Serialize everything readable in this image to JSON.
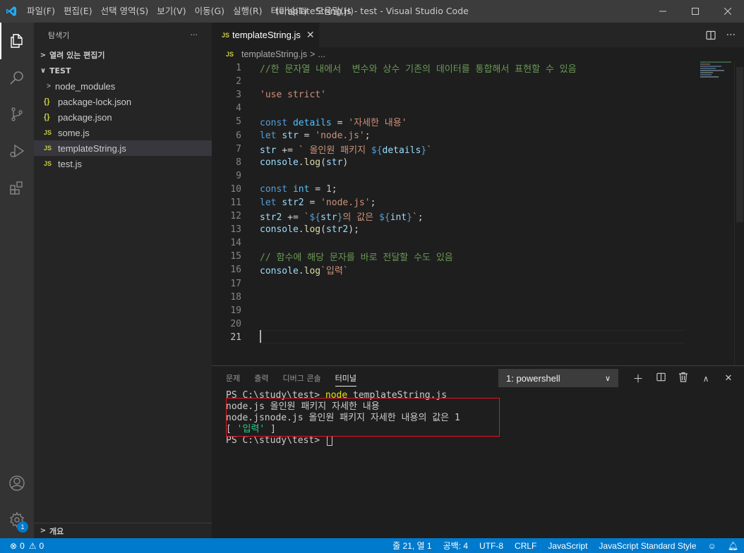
{
  "window": {
    "title": "templateString.js - test - Visual Studio Code",
    "menu": [
      "파일(F)",
      "편집(E)",
      "선택 영역(S)",
      "보기(V)",
      "이동(G)",
      "실행(R)",
      "터미널(T)",
      "도움말(H)"
    ]
  },
  "sidebar": {
    "header": "탐색기",
    "more": "···",
    "open_editors": "열려 있는 편집기",
    "folder": "TEST",
    "items": [
      {
        "icon": "",
        "label": "node_modules",
        "kind": "folder"
      },
      {
        "icon": "{}",
        "label": "package-lock.json",
        "kind": "json"
      },
      {
        "icon": "{}",
        "label": "package.json",
        "kind": "json"
      },
      {
        "icon": "JS",
        "label": "some.js",
        "kind": "js"
      },
      {
        "icon": "JS",
        "label": "templateString.js",
        "kind": "js"
      },
      {
        "icon": "JS",
        "label": "test.js",
        "kind": "js"
      }
    ],
    "outline": "개요"
  },
  "editor": {
    "tab_icon": "JS",
    "tab_label": "templateString.js",
    "tab_close": "✕",
    "breadcrumb_icon": "JS",
    "breadcrumb_file": "templateString.js",
    "breadcrumb_sep": ">",
    "breadcrumb_more": "...",
    "line_numbers": [
      "1",
      "2",
      "3",
      "4",
      "5",
      "6",
      "7",
      "8",
      "9",
      "10",
      "11",
      "12",
      "13",
      "14",
      "15",
      "16",
      "17",
      "18",
      "19",
      "20",
      "21"
    ],
    "lines": [
      {
        "text": "//한 문자열 내에서  변수와 상수 기존의 데이터를 통합해서 표현할 수 있음"
      },
      {
        "text": ""
      },
      {
        "text": "'use strict'"
      },
      {
        "text": ""
      },
      {
        "text": "const details = '자세한 내용'"
      },
      {
        "text": "let str = 'node.js';"
      },
      {
        "text": "str += ` 올인원 패키지 ${details}`"
      },
      {
        "text": "console.log(str)"
      },
      {
        "text": ""
      },
      {
        "text": "const int = 1;"
      },
      {
        "text": "let str2 = 'node.js';"
      },
      {
        "text": "str2 += `${str}의 값은 ${int}`;"
      },
      {
        "text": "console.log(str2);"
      },
      {
        "text": ""
      },
      {
        "text": "// 함수에 해당 문자를 바로 전달할 수도 있음"
      },
      {
        "text": "console.log`입력`"
      },
      {
        "text": ""
      },
      {
        "text": ""
      },
      {
        "text": ""
      },
      {
        "text": ""
      },
      {
        "text": ""
      }
    ]
  },
  "panel": {
    "tabs": [
      "문제",
      "출력",
      "디버그 콘솔",
      "터미널"
    ],
    "active_tab": "터미널",
    "terminal_select": "1: powershell",
    "terminal": {
      "prompt1": "PS C:\\study\\test> ",
      "command": "node",
      "command_args": " templateString.js",
      "out1": "node.js 올인원 패키지 자세한 내용",
      "out2": "node.jsnode.js 올인원 패키지 자세한 내용의 값은 1",
      "out3_open": "[ ",
      "out3_str": "'입력'",
      "out3_close": " ]",
      "prompt2": "PS C:\\study\\test> "
    }
  },
  "statusbar": {
    "errors": "0",
    "warnings": "0",
    "position": "줄 21, 열 1",
    "spaces": "공백: 4",
    "encoding": "UTF-8",
    "eol": "CRLF",
    "language": "JavaScript",
    "formatter": "JavaScript Standard Style"
  },
  "colors": {
    "accent": "#007acc",
    "highlight_box": "#e81123"
  }
}
